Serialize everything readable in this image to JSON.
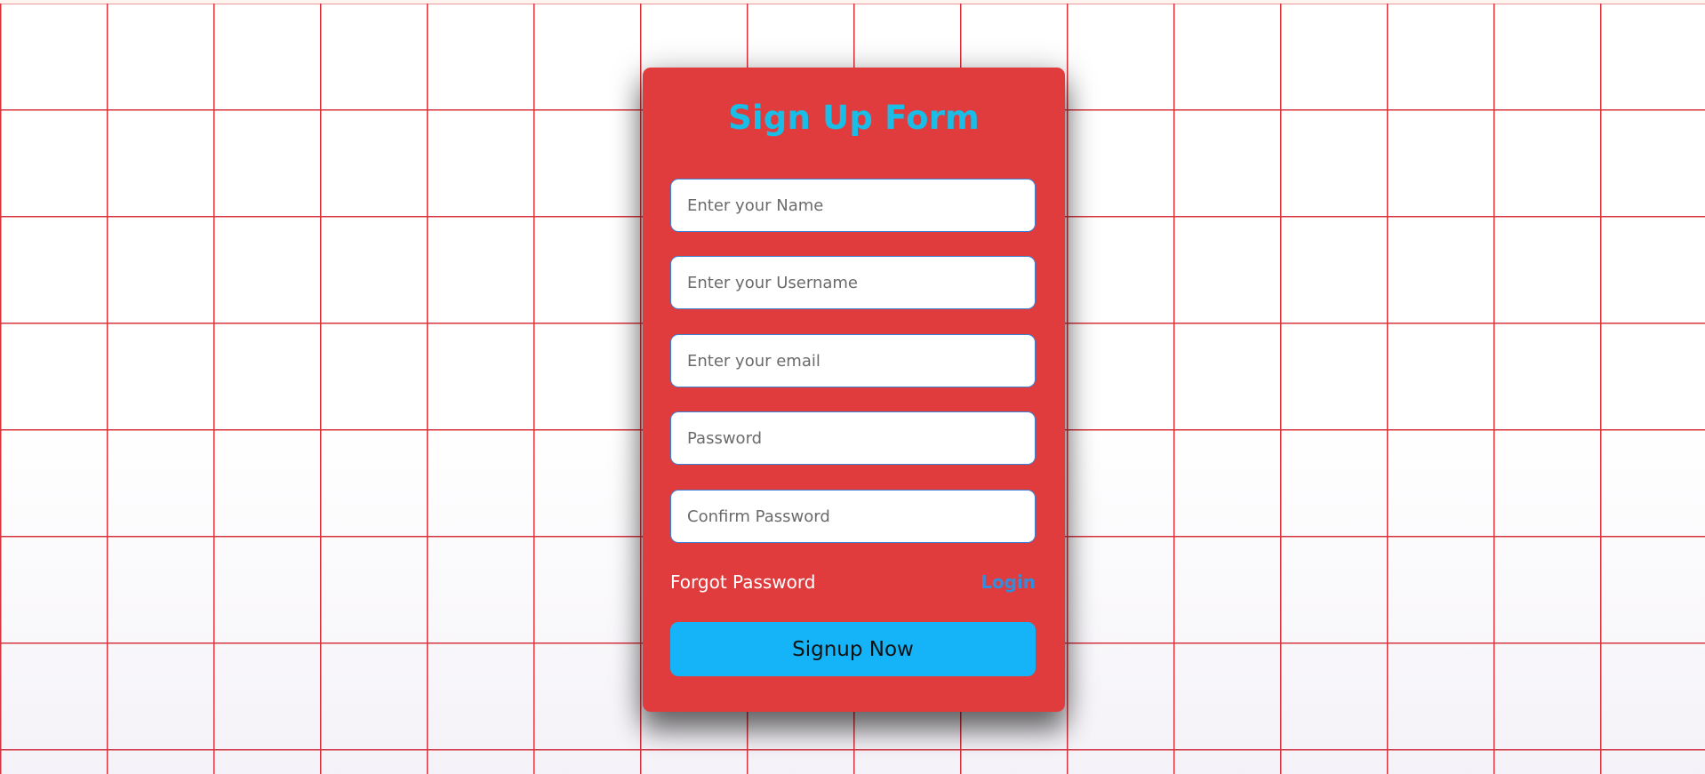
{
  "form": {
    "title": "Sign Up Form",
    "fields": [
      {
        "name": "name",
        "placeholder": "Enter your Name",
        "value": ""
      },
      {
        "name": "username",
        "placeholder": "Enter your Username",
        "value": ""
      },
      {
        "name": "email",
        "placeholder": "Enter your email",
        "value": ""
      },
      {
        "name": "password",
        "placeholder": "Password",
        "value": ""
      },
      {
        "name": "confirm_password",
        "placeholder": "Confirm Password",
        "value": ""
      }
    ],
    "forgot_label": "Forgot Password",
    "login_label": "Login",
    "submit_label": "Signup Now"
  },
  "colors": {
    "card_background": "#e03c3e",
    "title": "#19bde6",
    "field_border": "#3b82d6",
    "login_link": "#2e8fe0",
    "submit_background": "#15b4f8",
    "grid_lines": "#d9333a"
  }
}
